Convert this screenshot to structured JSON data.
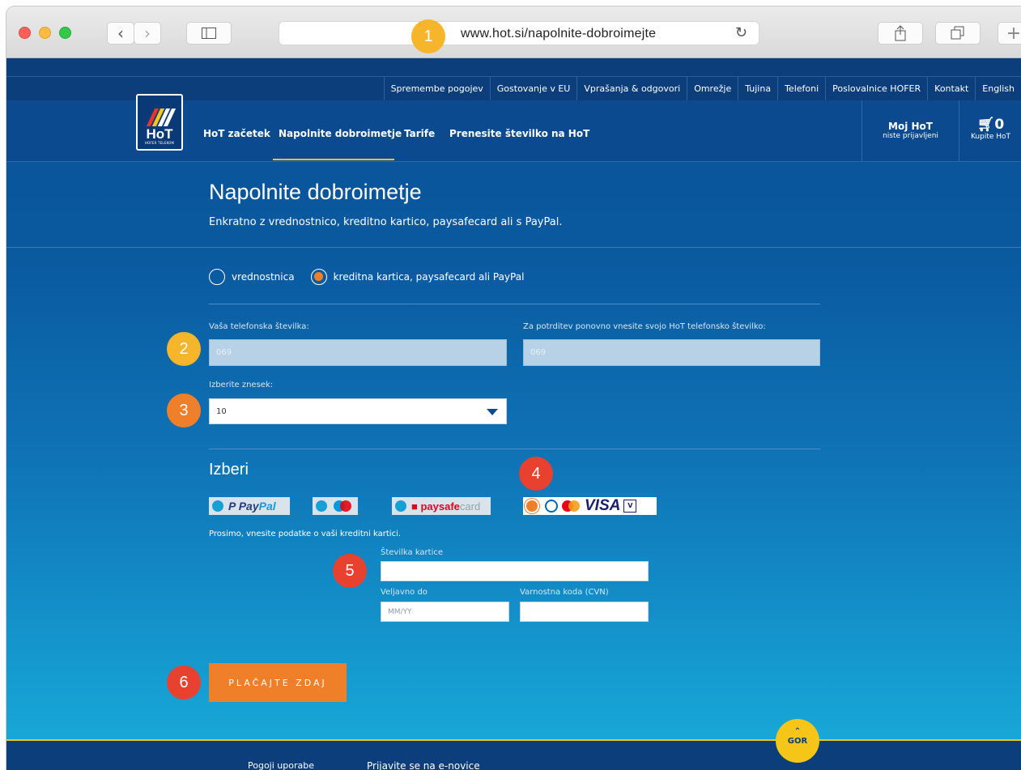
{
  "browser": {
    "url": "www.hot.si/napolnite-dobroimejte",
    "icons": [
      "back-icon",
      "forward-icon",
      "sidebar-icon",
      "reload-icon",
      "share-icon",
      "tabs-icon",
      "new-tab-icon"
    ]
  },
  "util_nav": [
    "Spremembe pogojev",
    "Gostovanje v EU",
    "Vprašanja & odgovori",
    "Omrežje",
    "Tujina",
    "Telefoni",
    "Poslovalnice HOFER",
    "Kontakt",
    "English"
  ],
  "logo": {
    "text": "HoT",
    "sub": "HOFER TELEKOM"
  },
  "main_nav": [
    "HoT začetek",
    "Napolnite dobroimetje",
    "Tarife",
    "Prenesite številko na HoT"
  ],
  "account": {
    "title": "Moj HoT",
    "status": "niste prijavljeni"
  },
  "cart": {
    "count": "0",
    "label": "Kupite HoT"
  },
  "page": {
    "title": "Napolnite dobroimetje",
    "subtitle": "Enkratno z vrednostnico, kreditno kartico, paysafecard ali s PayPal."
  },
  "method": {
    "option_voucher": "vrednostnica",
    "option_card": "kreditna kartica, paysafecard ali PayPal",
    "selected": "card"
  },
  "phone": {
    "label": "Vaša telefonska številka:",
    "placeholder": "069",
    "confirm_label": "Za potrditev ponovno vnesite svojo HoT telefonsko številko:",
    "confirm_placeholder": "069"
  },
  "amount": {
    "label": "Izberite znesek:",
    "value": "10"
  },
  "payment": {
    "heading": "Izberi",
    "paypal_a": "P",
    "paypal_b": "Pay",
    "paypal_c": "Pal",
    "psc_a": "paysafe",
    "psc_b": "card",
    "visa": "VISA",
    "vpay": "V"
  },
  "card_form": {
    "prompt": "Prosimo, vnesite podatke o vaši kreditni kartici.",
    "number_label": "Številka kartice",
    "expiry_label": "Veljavno do",
    "expiry_placeholder": "MM/YY",
    "cvn_label": "Varnostna koda (CVN)"
  },
  "submit": "PLAČAJTE ZDAJ",
  "back_to_top": "GOR",
  "footer": [
    "Pogoji uporabe",
    "Prijavite se na e-novice"
  ],
  "badges": [
    "1",
    "2",
    "3",
    "4",
    "5",
    "6"
  ],
  "colors": {
    "accent_orange": "#f07f2a",
    "brand_blue": "#0b4a8e",
    "yellow": "#f5c518",
    "badge_red": "#e8412f",
    "badge_yellow": "#f7b52c"
  }
}
